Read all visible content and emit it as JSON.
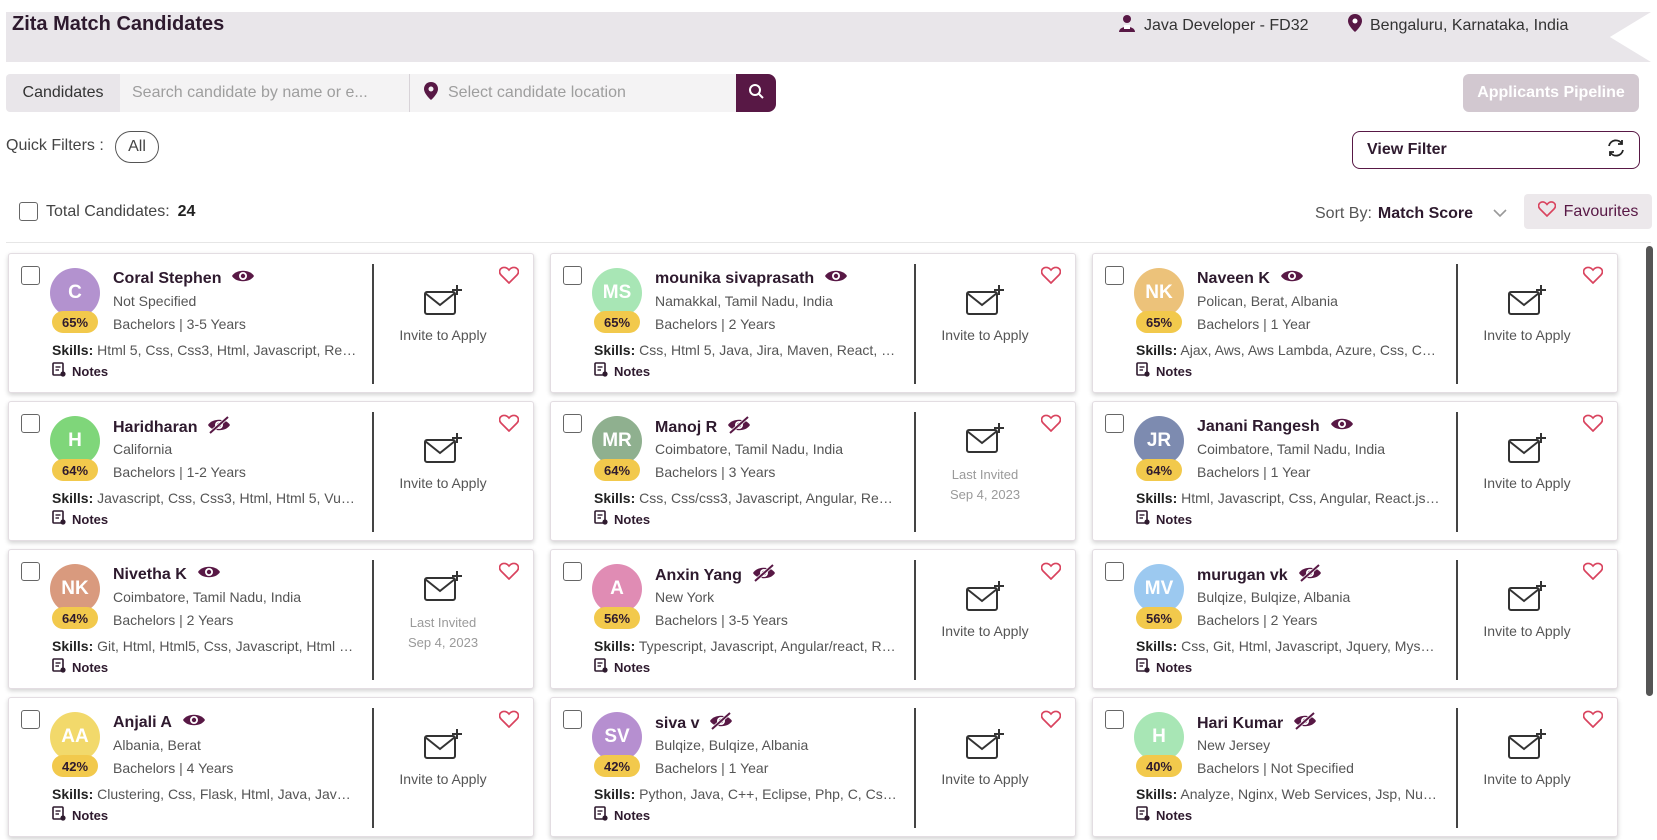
{
  "header": {
    "title": "Zita Match Candidates",
    "job": "Java Developer - FD32",
    "location": "Bengaluru, Karnataka, India"
  },
  "search": {
    "label": "Candidates",
    "name_placeholder": "Search candidate by name or e...",
    "location_placeholder": "Select candidate location"
  },
  "pipeline_button": "Applicants Pipeline",
  "quick_filters": {
    "label": "Quick Filters :",
    "all": "All"
  },
  "view_filter": "View Filter",
  "total": {
    "label": "Total Candidates:",
    "count": "24"
  },
  "sort": {
    "label": "Sort By:",
    "value": "Match Score"
  },
  "favourites": "Favourites",
  "colors": {
    "brand": "#581845",
    "match_badge": "#f2c94c"
  },
  "candidates": [
    {
      "initials": "C",
      "name": "Coral Stephen",
      "visibility": "eye-icon",
      "location": "Not Specified",
      "education": "Bachelors | 3-5 Years",
      "match": "65%",
      "skills": "Html 5, Css, Css3, Html, Javascript, React ...",
      "invite": "Invite to Apply",
      "last_invited": "",
      "avatar_color": "#b392cf"
    },
    {
      "initials": "MS",
      "name": "mounika sivaprasath",
      "visibility": "eye-icon",
      "location": "Namakkal, Tamil Nadu, India",
      "education": "Bachelors | 2 Years",
      "match": "65%",
      "skills": "Css, Html 5, Java, Jira, Maven, React, Rea...",
      "invite": "Invite to Apply",
      "last_invited": "",
      "avatar_color": "#a8e6b5"
    },
    {
      "initials": "NK",
      "name": "Naveen K",
      "visibility": "eye-icon",
      "location": "Polican, Berat, Albania",
      "education": "Bachelors | 1 Year",
      "match": "65%",
      "skills": "Ajax, Aws, Aws Lambda, Azure, Css, Css3, ...",
      "invite": "Invite to Apply",
      "last_invited": "",
      "avatar_color": "#ecc27a"
    },
    {
      "initials": "H",
      "name": "Haridharan",
      "visibility": "eye-off-icon",
      "location": "California",
      "education": "Bachelors | 1-2 Years",
      "match": "64%",
      "skills": "Javascript, Css, Css3, Html, Html 5, Vuejs, ...",
      "invite": "Invite to Apply",
      "last_invited": "",
      "avatar_color": "#7fd67a"
    },
    {
      "initials": "MR",
      "name": "Manoj R",
      "visibility": "eye-off-icon",
      "location": "Coimbatore, Tamil Nadu, India",
      "education": "Bachelors | 3 Years",
      "match": "64%",
      "skills": "Css, Css/css3, Javascript, Angular, React, ...",
      "invite": "Last Invited",
      "last_invited": "Sep 4, 2023",
      "avatar_color": "#8fb08f"
    },
    {
      "initials": "JR",
      "name": "Janani Rangesh",
      "visibility": "eye-icon",
      "location": "Coimbatore, Tamil Nadu, India",
      "education": "Bachelors | 1 Year",
      "match": "64%",
      "skills": "Html, Javascript, Css, Angular, React.js, Re...",
      "invite": "Invite to Apply",
      "last_invited": "",
      "avatar_color": "#7d8bb0"
    },
    {
      "initials": "NK",
      "name": "Nivetha K",
      "visibility": "eye-icon",
      "location": "Coimbatore, Tamil Nadu, India",
      "education": "Bachelors | 2 Years",
      "match": "64%",
      "skills": "Git, Html, Html5, Css, Javascript, Html 5, R...",
      "invite": "Last Invited",
      "last_invited": "Sep 4, 2023",
      "avatar_color": "#d99a7e"
    },
    {
      "initials": "A",
      "name": "Anxin Yang",
      "visibility": "eye-off-icon",
      "location": "New York",
      "education": "Bachelors | 3-5 Years",
      "match": "56%",
      "skills": "Typescript, Javascript, Angular/react, Rea...",
      "invite": "Invite to Apply",
      "last_invited": "",
      "avatar_color": "#e08cb4"
    },
    {
      "initials": "MV",
      "name": "murugan vk",
      "visibility": "eye-off-icon",
      "location": "Bulqize, Bulqize, Albania",
      "education": "Bachelors | 2 Years",
      "match": "56%",
      "skills": "Css, Git, Html, Javascript, Jquery, Mysql, P...",
      "invite": "Invite to Apply",
      "last_invited": "",
      "avatar_color": "#9cc9f0"
    },
    {
      "initials": "AA",
      "name": "Anjali A",
      "visibility": "eye-icon",
      "location": "Albania, Berat",
      "education": "Bachelors | 4 Years",
      "match": "42%",
      "skills": "Clustering, Css, Flask, Html, Java, Javascri...",
      "invite": "Invite to Apply",
      "last_invited": "",
      "avatar_color": "#f2d96b"
    },
    {
      "initials": "SV",
      "name": "siva v",
      "visibility": "eye-off-icon",
      "location": "Bulqize, Bulqize, Albania",
      "education": "Bachelors | 1 Year",
      "match": "42%",
      "skills": "Python, Java, C++, Eclipse, Php, C, Css, Vis...",
      "invite": "Invite to Apply",
      "last_invited": "",
      "avatar_color": "#b68fd0"
    },
    {
      "initials": "H",
      "name": "Hari Kumar",
      "visibility": "eye-off-icon",
      "location": "New Jersey",
      "education": "Bachelors | Not Specified",
      "match": "40%",
      "skills": "Analyze, Nginx, Web Services, Jsp, Numpy,...",
      "invite": "Invite to Apply",
      "last_invited": "",
      "avatar_color": "#a8e6b5"
    }
  ],
  "labels": {
    "skills": "Skills:",
    "notes": "Notes"
  }
}
